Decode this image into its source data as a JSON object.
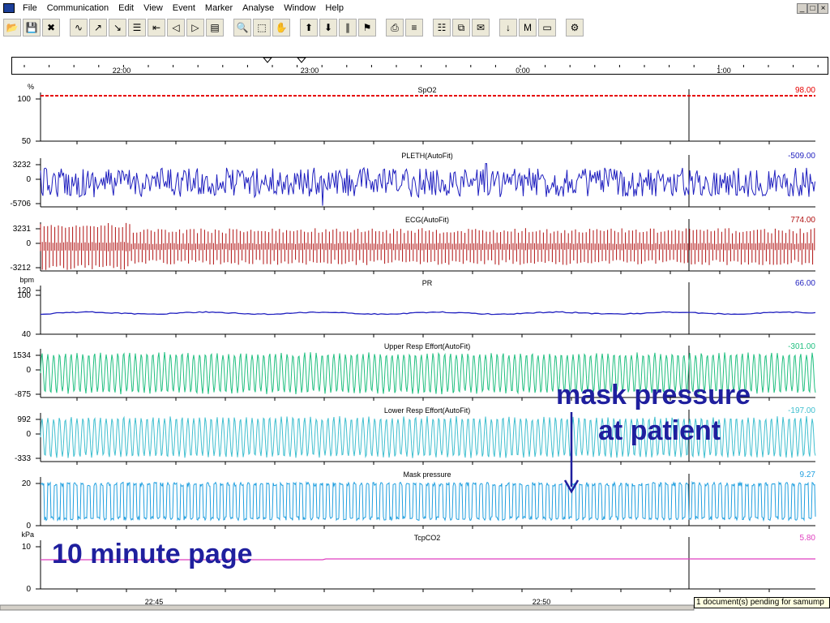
{
  "menu": {
    "items": [
      "File",
      "Communication",
      "Edit",
      "View",
      "Event",
      "Marker",
      "Analyse",
      "Window",
      "Help"
    ],
    "window_controls": [
      "_",
      "□",
      "×"
    ]
  },
  "toolbar": {
    "buttons": [
      {
        "name": "open-icon",
        "glyph": "📂"
      },
      {
        "name": "save-icon",
        "glyph": "💾"
      },
      {
        "name": "delete-icon",
        "glyph": "✖"
      },
      {
        "name": "channels-icon",
        "glyph": "∿"
      },
      {
        "name": "expand-up-icon",
        "glyph": "↗"
      },
      {
        "name": "collapse-icon",
        "glyph": "↘"
      },
      {
        "name": "align-icon",
        "glyph": "☰"
      },
      {
        "name": "scroll-left-icon",
        "glyph": "⇤"
      },
      {
        "name": "prev-icon",
        "glyph": "◁"
      },
      {
        "name": "next-icon",
        "glyph": "▷"
      },
      {
        "name": "color-icon",
        "glyph": "▤"
      },
      {
        "name": "zoom-icon",
        "glyph": "🔍"
      },
      {
        "name": "select-icon",
        "glyph": "⬚"
      },
      {
        "name": "hand-icon",
        "glyph": "✋"
      },
      {
        "name": "event-in-icon",
        "glyph": "⬆"
      },
      {
        "name": "event-out-icon",
        "glyph": "⬇"
      },
      {
        "name": "ruler-icon",
        "glyph": "∥"
      },
      {
        "name": "bookmark-icon",
        "glyph": "⚑"
      },
      {
        "name": "print-icon",
        "glyph": "⎙"
      },
      {
        "name": "list-icon",
        "glyph": "≡"
      },
      {
        "name": "report-icon",
        "glyph": "☷"
      },
      {
        "name": "multi-window-icon",
        "glyph": "⧉"
      },
      {
        "name": "pdf-icon",
        "glyph": "✉"
      },
      {
        "name": "arrow-down-icon",
        "glyph": "↓"
      },
      {
        "name": "marker-m-icon",
        "glyph": "M"
      },
      {
        "name": "monitor-icon",
        "glyph": "▭"
      },
      {
        "name": "settings-icon",
        "glyph": "⚙"
      }
    ]
  },
  "timeline": {
    "top_labels": [
      "22:00",
      "23:00",
      "0:00",
      "1:00"
    ],
    "bottom_labels": [
      "22:45",
      "22:50"
    ]
  },
  "channels": [
    {
      "id": "spo2",
      "title": "SpO2",
      "unit": "%",
      "value": "98.00",
      "color": "#e60000",
      "ticks": [
        "100",
        "50"
      ],
      "style": "flat_dashed",
      "level": 98
    },
    {
      "id": "pleth",
      "title": "PLETH(AutoFit)",
      "unit": "",
      "value": "-509.00",
      "color": "#1f1fbf",
      "ticks": [
        "3232",
        "0",
        "-5706"
      ],
      "style": "noise",
      "amp": 0.55
    },
    {
      "id": "ecg",
      "title": "ECG(AutoFit)",
      "unit": "",
      "value": "774.00",
      "color": "#b01010",
      "ticks": [
        "3231",
        "0",
        "-3212"
      ],
      "style": "dense",
      "amp": 0.85
    },
    {
      "id": "pr",
      "title": "PR",
      "unit": "bpm",
      "value": "66.00",
      "color": "#1f1fbf",
      "ticks": [
        "120",
        "100",
        "40"
      ],
      "style": "flat",
      "level": 66
    },
    {
      "id": "upper",
      "title": "Upper Resp Effort(AutoFit)",
      "unit": "",
      "value": "-301.00",
      "color": "#1fbf7f",
      "ticks": [
        "1534",
        "0",
        "-875"
      ],
      "style": "resp",
      "amp": 0.8
    },
    {
      "id": "lower",
      "title": "Lower Resp Effort(AutoFit)",
      "unit": "",
      "value": "-197.00",
      "color": "#3fbfcf",
      "ticks": [
        "992",
        "0",
        "-333"
      ],
      "style": "resp",
      "amp": 0.75
    },
    {
      "id": "mask",
      "title": "Mask pressure",
      "unit": "",
      "value": "9.27",
      "color": "#1f9fdf",
      "ticks": [
        "20",
        "0"
      ],
      "style": "mask",
      "amp": 0.8
    },
    {
      "id": "tcpco2",
      "title": "TcpCO2",
      "unit": "kPa",
      "value": "5.80",
      "color": "#df3fbf",
      "ticks": [
        "10",
        "0"
      ],
      "style": "flat",
      "level": 5.8
    }
  ],
  "annotations": {
    "mask_line1": "mask pressure",
    "mask_line2": "at patient",
    "page_label": "10 minute page"
  },
  "status": {
    "text": "1 document(s) pending for samump"
  }
}
